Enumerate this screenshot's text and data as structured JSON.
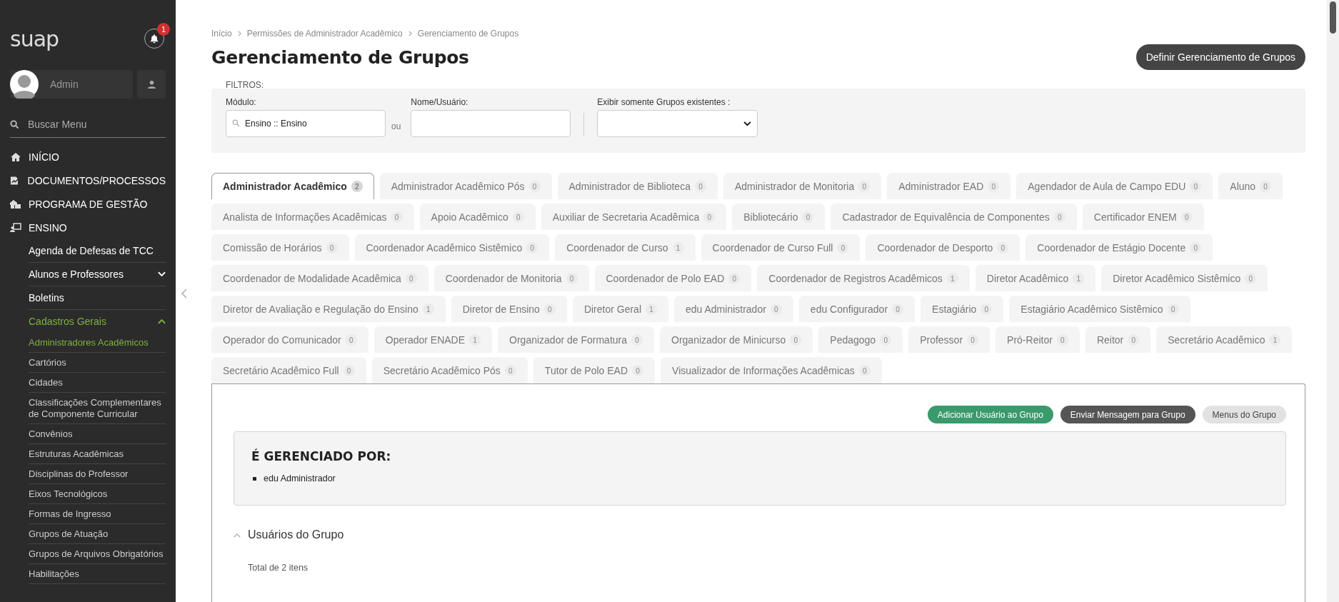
{
  "sidebar": {
    "logo": "suap",
    "notifications": {
      "count": "1"
    },
    "user": {
      "name": "Admin"
    },
    "search": {
      "placeholder": "Buscar Menu"
    },
    "menu": [
      {
        "label": "INÍCIO"
      },
      {
        "label": "DOCUMENTOS/PROCESSOS"
      },
      {
        "label": "PROGRAMA DE GESTÃO"
      },
      {
        "label": "ENSINO",
        "children": [
          {
            "label": "Agenda de Defesas de TCC",
            "kind": "link"
          },
          {
            "label": "Alunos e Professores",
            "kind": "group",
            "expanded": false
          },
          {
            "label": "Boletins",
            "kind": "link"
          },
          {
            "label": "Cadastros Gerais",
            "kind": "group",
            "expanded": true,
            "children": [
              {
                "label": "Administradores Acadêmicos",
                "selected": true
              },
              {
                "label": "Cartórios",
                "selected": false
              },
              {
                "label": "Cidades",
                "selected": false
              },
              {
                "label": "Classificações Complementares de Componente Curricular",
                "selected": false
              },
              {
                "label": "Convênios",
                "selected": false
              },
              {
                "label": "Estruturas Acadêmicas",
                "selected": false
              },
              {
                "label": "Disciplinas do Professor",
                "selected": false
              },
              {
                "label": "Eixos Tecnológicos",
                "selected": false
              },
              {
                "label": "Formas de Ingresso",
                "selected": false
              },
              {
                "label": "Grupos de Atuação",
                "selected": false
              },
              {
                "label": "Grupos de Arquivos Obrigatórios",
                "selected": false
              },
              {
                "label": "Habilitações",
                "selected": false
              }
            ]
          }
        ]
      }
    ]
  },
  "breadcrumbs": [
    "Início",
    "Permissões de Administrador Acadêmico",
    "Gerenciamento de Grupos"
  ],
  "title": "Gerenciamento de Grupos",
  "action_button": "Definir Gerenciamento de Grupos",
  "filters": {
    "legend": "FILTROS:",
    "module": {
      "label": "Módulo:",
      "value": "Ensino :: Ensino"
    },
    "separator": "ou",
    "name": {
      "label": "Nome/Usuário:"
    },
    "existing": {
      "label": "Exibir somente Grupos existentes :"
    }
  },
  "tabs": [
    {
      "label": "Administrador Acadêmico",
      "count": "2",
      "selected": true
    },
    {
      "label": "Administrador Acadêmico Pós",
      "count": "0",
      "selected": false
    },
    {
      "label": "Administrador de Biblioteca",
      "count": "0",
      "selected": false
    },
    {
      "label": "Administrador de Monitoria",
      "count": "0",
      "selected": false
    },
    {
      "label": "Administrador EAD",
      "count": "0",
      "selected": false
    },
    {
      "label": "Agendador de Aula de Campo EDU",
      "count": "0",
      "selected": false
    },
    {
      "label": "Aluno",
      "count": "0",
      "selected": false
    },
    {
      "label": "Analista de Informações Acadêmicas",
      "count": "0",
      "selected": false
    },
    {
      "label": "Apoio Acadêmico",
      "count": "0",
      "selected": false
    },
    {
      "label": "Auxiliar de Secretaria Acadêmica",
      "count": "0",
      "selected": false
    },
    {
      "label": "Bibliotecário",
      "count": "0",
      "selected": false
    },
    {
      "label": "Cadastrador de Equivalência de Componentes",
      "count": "0",
      "selected": false
    },
    {
      "label": "Certificador ENEM",
      "count": "0",
      "selected": false
    },
    {
      "label": "Comissão de Horários",
      "count": "0",
      "selected": false
    },
    {
      "label": "Coordenador Acadêmico Sistêmico",
      "count": "0",
      "selected": false
    },
    {
      "label": "Coordenador de Curso",
      "count": "1",
      "selected": false
    },
    {
      "label": "Coordenador de Curso Full",
      "count": "0",
      "selected": false
    },
    {
      "label": "Coordenador de Desporto",
      "count": "0",
      "selected": false
    },
    {
      "label": "Coordenador de Estágio Docente",
      "count": "0",
      "selected": false
    },
    {
      "label": "Coordenador de Modalidade Acadêmica",
      "count": "0",
      "selected": false
    },
    {
      "label": "Coordenador de Monitoria",
      "count": "0",
      "selected": false
    },
    {
      "label": "Coordenador de Polo EAD",
      "count": "0",
      "selected": false
    },
    {
      "label": "Coordenador de Registros Acadêmicos",
      "count": "1",
      "selected": false
    },
    {
      "label": "Diretor Acadêmico",
      "count": "1",
      "selected": false
    },
    {
      "label": "Diretor Acadêmico Sistêmico",
      "count": "0",
      "selected": false
    },
    {
      "label": "Diretor de Avaliação e Regulação do Ensino",
      "count": "1",
      "selected": false
    },
    {
      "label": "Diretor de Ensino",
      "count": "0",
      "selected": false
    },
    {
      "label": "Diretor Geral",
      "count": "1",
      "selected": false
    },
    {
      "label": "edu Administrador",
      "count": "0",
      "selected": false
    },
    {
      "label": "edu Configurador",
      "count": "0",
      "selected": false
    },
    {
      "label": "Estagiário",
      "count": "0",
      "selected": false
    },
    {
      "label": "Estagiário Acadêmico Sistêmico",
      "count": "0",
      "selected": false
    },
    {
      "label": "Operador do Comunicador",
      "count": "0",
      "selected": false
    },
    {
      "label": "Operador ENADE",
      "count": "1",
      "selected": false
    },
    {
      "label": "Organizador de Formatura",
      "count": "0",
      "selected": false
    },
    {
      "label": "Organizador de Minicurso",
      "count": "0",
      "selected": false
    },
    {
      "label": "Pedagogo",
      "count": "0",
      "selected": false
    },
    {
      "label": "Professor",
      "count": "0",
      "selected": false
    },
    {
      "label": "Pró-Reitor",
      "count": "0",
      "selected": false
    },
    {
      "label": "Reitor",
      "count": "0",
      "selected": false
    },
    {
      "label": "Secretário Acadêmico",
      "count": "1",
      "selected": false
    },
    {
      "label": "Secretário Acadêmico Full",
      "count": "0",
      "selected": false
    },
    {
      "label": "Secretário Acadêmico Pós",
      "count": "0",
      "selected": false
    },
    {
      "label": "Tutor de Polo EAD",
      "count": "0",
      "selected": false
    },
    {
      "label": "Visualizador de Informações Acadêmicas",
      "count": "0",
      "selected": false
    }
  ],
  "panel": {
    "buttons": [
      {
        "label": "Adicionar Usuário ao Grupo",
        "kind": "success"
      },
      {
        "label": "Enviar Mensagem para Grupo",
        "kind": "dark"
      },
      {
        "label": "Menus do Grupo",
        "kind": "light"
      }
    ],
    "managed_by": {
      "title": "É GERENCIADO POR:",
      "items": [
        "edu Administrador"
      ]
    },
    "users": {
      "title": "Usuários do Grupo",
      "expanded": true,
      "total": "Total de 2 itens"
    }
  }
}
